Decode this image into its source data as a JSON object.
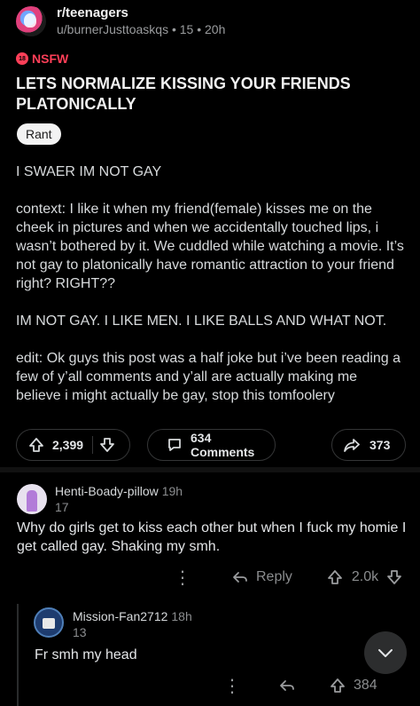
{
  "post": {
    "subreddit": "r/teenagers",
    "byline": "u/burnerJusttoaskqs • 15 • 20h",
    "nsfw_badge_icon": "18",
    "nsfw_label": "NSFW",
    "title": "LETS NORMALIZE KISSING YOUR FRIENDS PLATONICALLY",
    "flair": "Rant",
    "body": [
      "I SWAER IM NOT GAY",
      "context: I like it when my friend(female) kisses me on the cheek in pictures and when we accidentally touched lips, i wasn’t bothered by it. We cuddled while watching a movie. It’s not gay to platonically have romantic attraction to your friend right? RIGHT??",
      "IM NOT GAY. I LIKE MEN. I LIKE BALLS AND WHAT NOT.",
      "edit: Ok guys this post was a half joke but i’ve been reading a few of y’all comments and y’all are actually making me believe i might actually be gay, stop this tomfoolery"
    ],
    "votes": "2,399",
    "comments": "634 Comments",
    "shares": "373"
  },
  "comments": [
    {
      "user": "Henti-Boady-pillow",
      "time": "19h",
      "score": "17",
      "text": "Why do girls get to kiss each other but when I fuck my homie I get called gay. Shaking my smh.",
      "reply_label": "Reply",
      "votes": "2.0k"
    },
    {
      "user": "Mission-Fan2712",
      "time": "18h",
      "score": "13",
      "text": "Fr smh my head",
      "votes": "384"
    }
  ],
  "icons": [
    "subreddit-avatar",
    "nsfw-icon",
    "upvote-icon",
    "downvote-icon",
    "comment-icon",
    "share-icon",
    "more-dots-icon",
    "reply-icon",
    "chevron-down-icon"
  ],
  "colors": {
    "background": "#000000",
    "nsfw": "#ff3f58",
    "text": "#d7dadc",
    "muted": "#8b8d8f",
    "border": "#343536"
  }
}
